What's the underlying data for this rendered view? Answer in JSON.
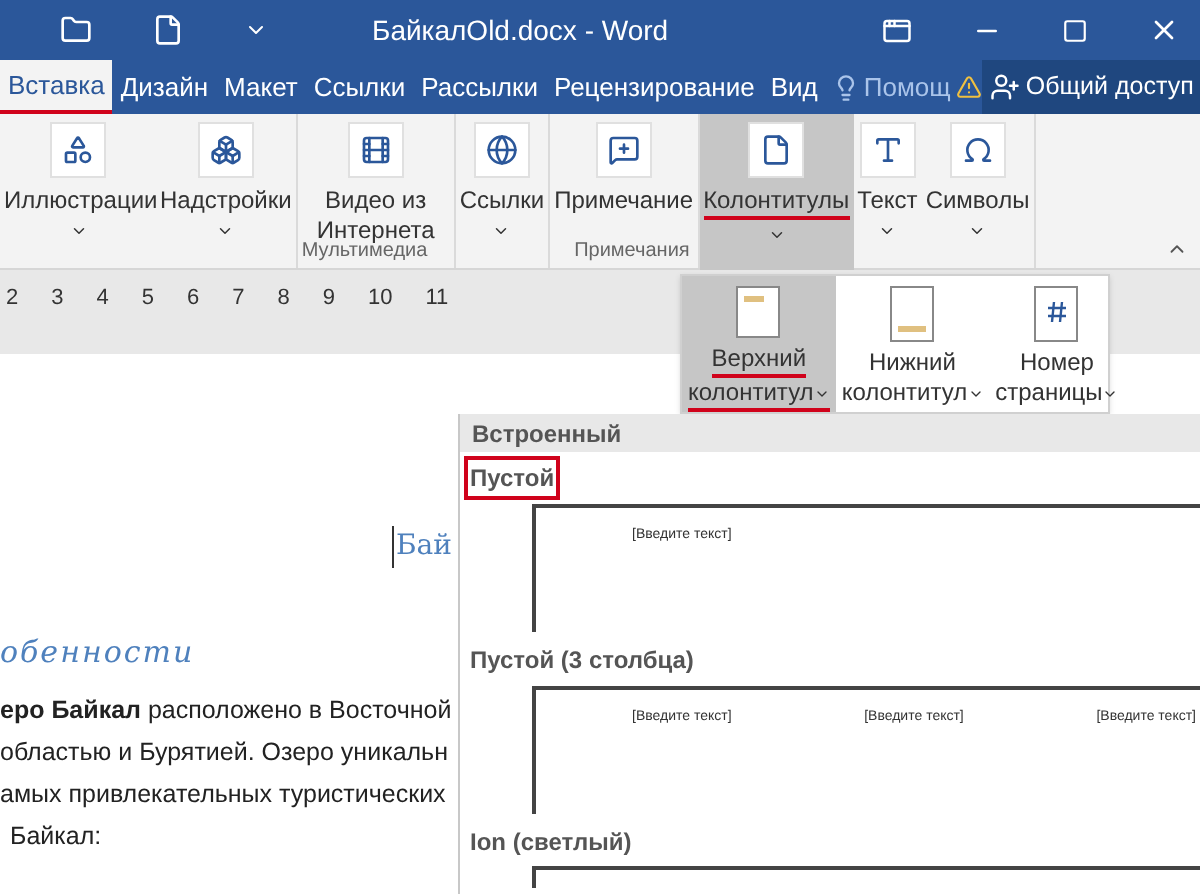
{
  "window": {
    "title": "БайкалOld.docx - Word"
  },
  "tabs": [
    {
      "label": "Вставка",
      "selected": true
    },
    {
      "label": "Дизайн",
      "selected": false
    },
    {
      "label": "Макет",
      "selected": false
    },
    {
      "label": "Ссылки",
      "selected": false
    },
    {
      "label": "Рассылки",
      "selected": false
    },
    {
      "label": "Рецензирование",
      "selected": false
    },
    {
      "label": "Вид",
      "selected": false
    }
  ],
  "help": {
    "placeholder": "Помощ"
  },
  "share_button": {
    "label": "Общий доступ"
  },
  "ribbon": [
    {
      "buttons": [
        {
          "label": "Иллюстрации",
          "dropdown": true,
          "selected": false
        },
        {
          "label": "Надстройки",
          "dropdown": true,
          "selected": false
        }
      ]
    },
    {
      "group_label": "Мультимедиа",
      "buttons": [
        {
          "label": "Видео из Интернета",
          "dropdown": false,
          "selected": false
        }
      ]
    },
    {
      "buttons": [
        {
          "label": "Ссылки",
          "dropdown": true,
          "selected": false
        }
      ]
    },
    {
      "group_label": "Примечания",
      "buttons": [
        {
          "label": "Примечание",
          "dropdown": false,
          "selected": false
        }
      ]
    },
    {
      "buttons": [
        {
          "label": "Колонтитулы",
          "dropdown": true,
          "selected": true
        },
        {
          "label": "Текст",
          "dropdown": true,
          "selected": false
        },
        {
          "label": "Символы",
          "dropdown": true,
          "selected": false
        }
      ]
    }
  ],
  "ruler": [
    "2",
    "3",
    "4",
    "5",
    "6",
    "7",
    "8",
    "9",
    "10",
    "11"
  ],
  "header_menu": [
    {
      "line1": "Верхний",
      "line2": "колонтитул",
      "selected": true
    },
    {
      "line1": "Нижний",
      "line2": "колонтитул",
      "selected": false
    },
    {
      "line1": "Номер",
      "line2": "страницы",
      "selected": false
    }
  ],
  "gallery": {
    "heading": "Встроенный",
    "items": [
      {
        "title": "Пустой",
        "highlighted": true,
        "placeholders": [
          "[Введите текст]"
        ]
      },
      {
        "title": "Пустой (3 столбца)",
        "highlighted": false,
        "placeholders": [
          "[Введите текст]",
          "[Введите текст]",
          "[Введите текст]"
        ]
      },
      {
        "title": "Ion (светлый)",
        "highlighted": false
      }
    ]
  },
  "document": {
    "title": "Бай",
    "section_heading": "обенности",
    "lines": [
      "**еро Байкал** расположено в Восточной",
      "областью и Бурятией. Озеро уникальн",
      "амых привлекательных туристических",
      "Байкал:"
    ]
  }
}
